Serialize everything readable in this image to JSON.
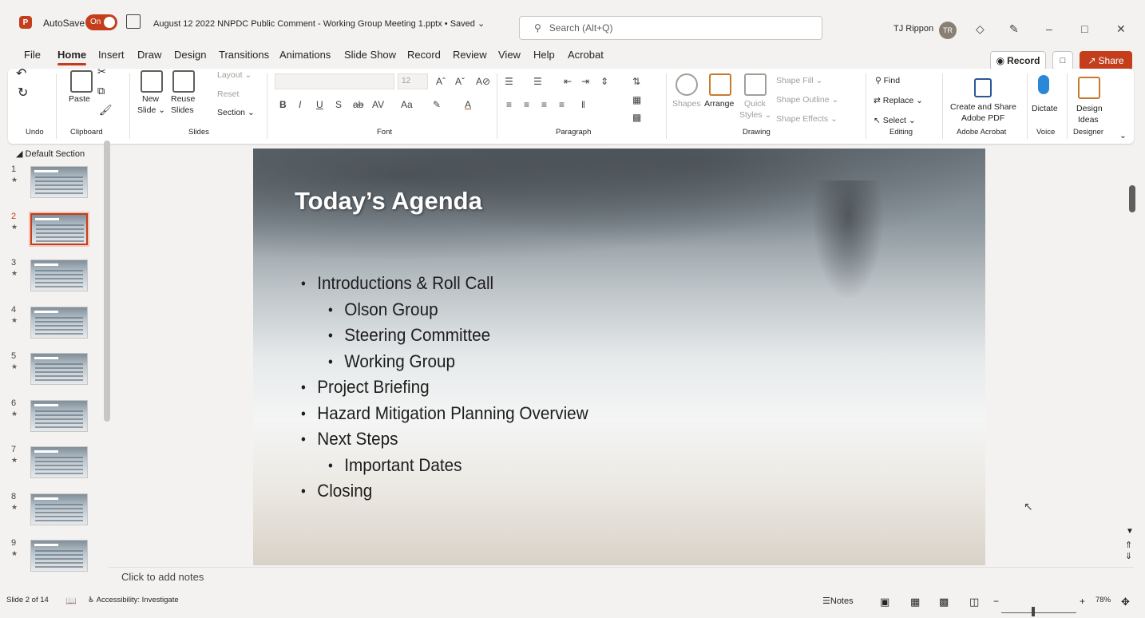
{
  "titlebar": {
    "autosave_label": "AutoSave",
    "autosave_state": "On",
    "doc_title": "August 12 2022 NNPDC Public Comment - Working Group Meeting 1.pptx • Saved ⌄",
    "search_placeholder": "Search (Alt+Q)",
    "user_name": "TJ Rippon",
    "user_initials": "TR"
  },
  "tabs": [
    "File",
    "Home",
    "Insert",
    "Draw",
    "Design",
    "Transitions",
    "Animations",
    "Slide Show",
    "Record",
    "Review",
    "View",
    "Help",
    "Acrobat"
  ],
  "actions": {
    "record": "Record",
    "share": "Share"
  },
  "ribbon": {
    "undo_group": "Undo",
    "clipboard": {
      "paste": "Paste",
      "label": "Clipboard"
    },
    "slides": {
      "new_slide": "New",
      "new_slide2": "Slide ⌄",
      "reuse": "Reuse",
      "reuse2": "Slides",
      "layout": "Layout ⌄",
      "reset": "Reset",
      "section": "Section ⌄",
      "label": "Slides"
    },
    "font": {
      "size": "12",
      "label": "Font"
    },
    "paragraph": {
      "label": "Paragraph"
    },
    "drawing": {
      "shapes": "Shapes",
      "arrange": "Arrange",
      "quick_styles": "Quick",
      "quick_styles2": "Styles ⌄",
      "shape_fill": "Shape Fill ⌄",
      "shape_outline": "Shape Outline ⌄",
      "shape_effects": "Shape Effects ⌄",
      "label": "Drawing"
    },
    "editing": {
      "find": "Find",
      "replace": "Replace ⌄",
      "select": "Select ⌄",
      "label": "Editing"
    },
    "acrobat": {
      "create": "Create and Share",
      "create2": "Adobe PDF",
      "label": "Adobe Acrobat"
    },
    "voice": {
      "dictate": "Dictate",
      "label": "Voice"
    },
    "designer": {
      "ideas": "Design",
      "ideas2": "Ideas",
      "label": "Designer"
    }
  },
  "panel": {
    "section": "Default Section",
    "slides": [
      "1",
      "2",
      "3",
      "4",
      "5",
      "6",
      "7",
      "8",
      "9"
    ],
    "active": 2
  },
  "slide": {
    "title": "Today’s Agenda",
    "items": [
      {
        "text": "Introductions & Roll Call",
        "level": 1
      },
      {
        "text": "Olson Group",
        "level": 2
      },
      {
        "text": "Steering Committee",
        "level": 2
      },
      {
        "text": "Working Group",
        "level": 2
      },
      {
        "text": "Project Briefing",
        "level": 1
      },
      {
        "text": "Hazard Mitigation Planning Overview",
        "level": 1
      },
      {
        "text": "Next Steps",
        "level": 1
      },
      {
        "text": "Important Dates",
        "level": 2
      },
      {
        "text": "Closing",
        "level": 1
      }
    ]
  },
  "notes_placeholder": "Click to add notes",
  "status": {
    "slide_count": "Slide 2 of 14",
    "accessibility": "Accessibility: Investigate",
    "notes": "Notes",
    "zoom": "78%"
  }
}
